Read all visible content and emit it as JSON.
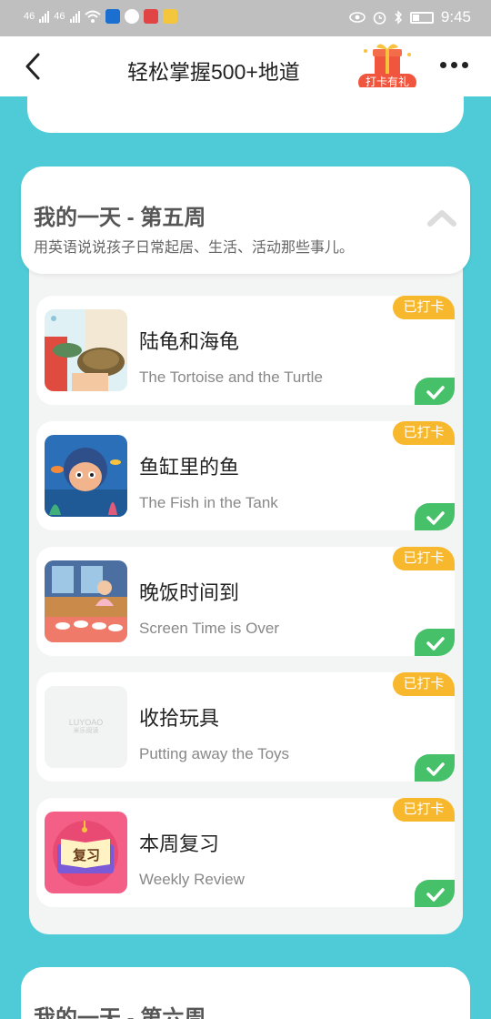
{
  "status": {
    "network_left": "46",
    "network_right": "46",
    "time": "9:45"
  },
  "nav": {
    "title": "轻松掌握500+地道",
    "gift_label": "打卡有礼"
  },
  "week5": {
    "title": "我的一天 - 第五周",
    "subtitle": "用英语说说孩子日常起居、生活、活动那些事儿。",
    "lessons": [
      {
        "title": "陆龟和海龟",
        "subtitle": "The Tortoise and the Turtle",
        "badge": "已打卡"
      },
      {
        "title": "鱼缸里的鱼",
        "subtitle": "The Fish in the Tank",
        "badge": "已打卡"
      },
      {
        "title": "晚饭时间到",
        "subtitle": "Screen Time is Over",
        "badge": "已打卡"
      },
      {
        "title": "收拾玩具",
        "subtitle": "Putting away the Toys",
        "badge": "已打卡"
      },
      {
        "title": "本周复习",
        "subtitle": "Weekly Review",
        "badge": "已打卡"
      }
    ]
  },
  "placeholder_logo": {
    "line1": "LUYOAO",
    "line2": "米乐阅读"
  },
  "review_thumb_text": "复习",
  "week6": {
    "title": "我的一天 - 第六周"
  },
  "colors": {
    "background": "#4ecbd6",
    "badge": "#f7b82e",
    "check": "#47c06a",
    "gift": "#f0553d"
  }
}
